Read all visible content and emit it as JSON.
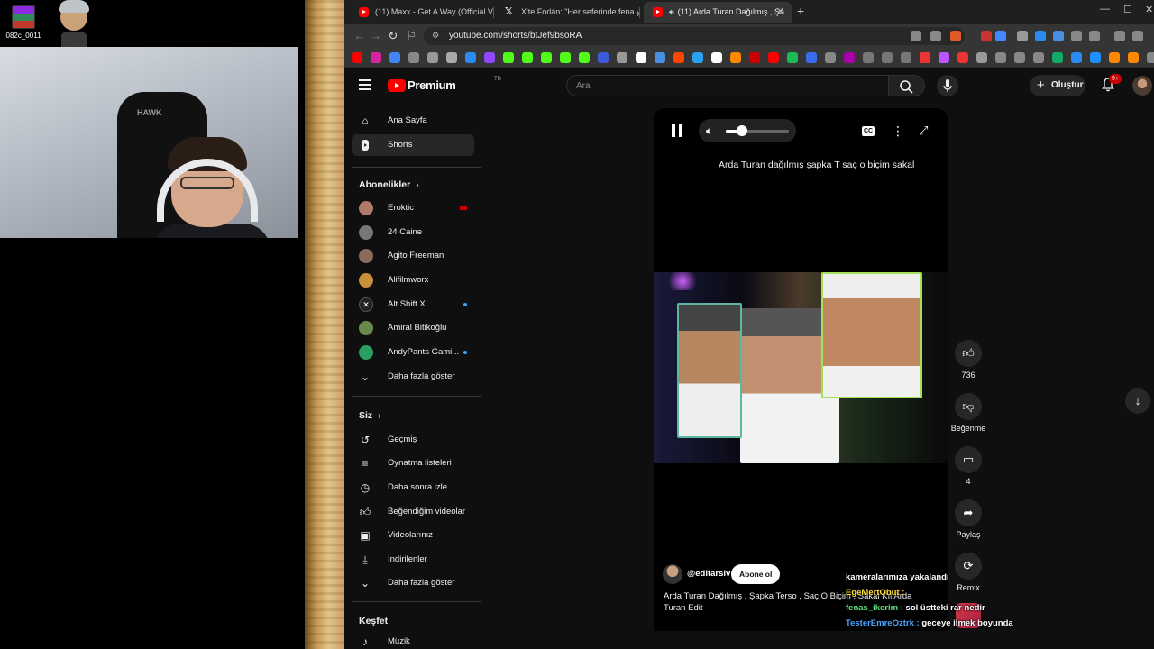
{
  "desktop": {
    "icon_label": "082c_0011"
  },
  "webcam": {
    "chair_logo": "HAWK"
  },
  "browser": {
    "tabs": [
      {
        "title": "(11) Maxx - Get A Way (Official Vide",
        "active": false
      },
      {
        "title": "X'te Forlán: \"Her seferinde fena yanıy",
        "active": false
      },
      {
        "title": "(11) Arda Turan Dağılmış , Şa",
        "active": true
      }
    ],
    "new_tab": "+",
    "url": "youtube.com/shorts/btJef9bsoRA"
  },
  "youtube": {
    "brand": "Premium",
    "region": "TR",
    "search_placeholder": "Ara",
    "create_label": "Oluştur",
    "notification_badge": "9+",
    "sidebar": {
      "main": [
        {
          "label": "Ana Sayfa",
          "icon": "home-icon",
          "active": false
        },
        {
          "label": "Shorts",
          "icon": "shorts-icon",
          "active": true
        }
      ],
      "subscriptions_title": "Abonelikler",
      "subscriptions": [
        {
          "label": "Eroktic",
          "badge": "live",
          "color": "#b07a6a"
        },
        {
          "label": "24 Caine",
          "badge": "",
          "color": "#777777"
        },
        {
          "label": "Agito Freeman",
          "badge": "",
          "color": "#8a6a5a"
        },
        {
          "label": "Alifilmworx",
          "badge": "",
          "color": "#c8903a"
        },
        {
          "label": "Alt Shift X",
          "badge": "new",
          "color": "#222222"
        },
        {
          "label": "Amiral Bitikoğlu",
          "badge": "",
          "color": "#6a8a4a"
        },
        {
          "label": "AndyPants Gami...",
          "badge": "new",
          "color": "#2aa060"
        }
      ],
      "show_more": "Daha fazla göster",
      "you_title": "Siz",
      "you": [
        {
          "label": "Geçmiş",
          "icon": "history-icon"
        },
        {
          "label": "Oynatma listeleri",
          "icon": "playlists-icon"
        },
        {
          "label": "Daha sonra izle",
          "icon": "watch-later-icon"
        },
        {
          "label": "Beğendiğim videolar",
          "icon": "liked-icon"
        },
        {
          "label": "Videolarınız",
          "icon": "your-videos-icon"
        },
        {
          "label": "İndirilenler",
          "icon": "downloads-icon"
        }
      ],
      "you_more": "Daha fazla göster",
      "explore_title": "Keşfet",
      "explore": [
        {
          "label": "Müzik",
          "icon": "music-icon"
        }
      ]
    },
    "player": {
      "caption": "Arda Turan dağılmış şapka T saç o biçim sakal",
      "volume": 0.26,
      "channel": "@editarsiv",
      "subscribe": "Abone ol",
      "description": "Arda Turan Dağılmış , Şapka Terso , Saç O Biçim , Sakal Kıl Arda Turan Edit"
    },
    "actions": {
      "likes": "736",
      "dislike": "Beğenme",
      "comments": "4",
      "share": "Paylaş",
      "remix": "Remix"
    }
  },
  "chat": [
    {
      "user": "",
      "text": "kameralarımıza yakalandı",
      "cls": "msg"
    },
    {
      "user": "EgeMertObut :",
      "text": "",
      "cls": "u2"
    },
    {
      "user": "fenas_ikerim :",
      "text": "sol üstteki rar nedir",
      "cls": "u3"
    },
    {
      "user": "TesterEmreOztrk :",
      "text": "geceye ilmek boyunda",
      "cls": "u4"
    }
  ]
}
